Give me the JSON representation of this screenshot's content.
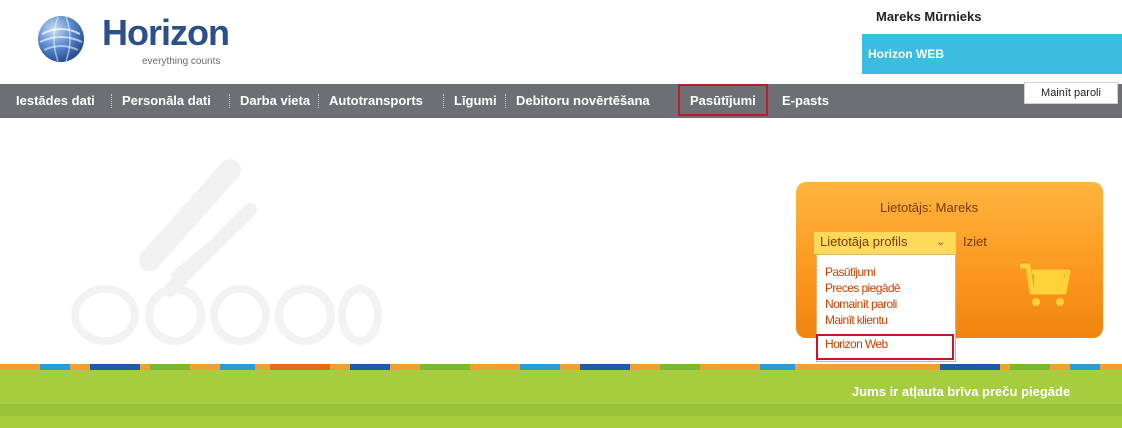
{
  "header": {
    "logo_name": "Horizon",
    "logo_tagline": "everything counts",
    "user_name": "Mareks Mūrnieks",
    "app_link": "Horizon WEB",
    "change_password": "Mainīt paroli"
  },
  "nav": {
    "items": [
      {
        "label": "Iestādes dati"
      },
      {
        "label": "Personāla dati"
      },
      {
        "label": "Darba vieta"
      },
      {
        "label": "Autotransports"
      },
      {
        "label": "Līgumi"
      },
      {
        "label": "Debitoru novērtēšana"
      },
      {
        "label": "Pasūtījumi"
      },
      {
        "label": "E-pasts"
      }
    ]
  },
  "shop_panel": {
    "user_label": "Lietotājs: Mareks",
    "profile_label": "Lietotāja profils",
    "logout_label": "Iziet",
    "dropdown": [
      {
        "label": "Pasūtījumi"
      },
      {
        "label": "Preces piegādē"
      },
      {
        "label": "Nomainīt paroli"
      },
      {
        "label": "Mainīt klientu"
      },
      {
        "label": "Horizon Web"
      }
    ]
  },
  "promo_text": "Jums ir atļauta brīva preču piegāde",
  "colors": {
    "nav_bg": "#6c6f74",
    "app_link_bg": "#3bbde2",
    "highlight_border": "#c3162f",
    "orange": "#fb961e",
    "green": "#a6cc3f"
  },
  "icons": [
    "horizon-globe-icon",
    "cart-icon",
    "chevron-down-icon"
  ]
}
